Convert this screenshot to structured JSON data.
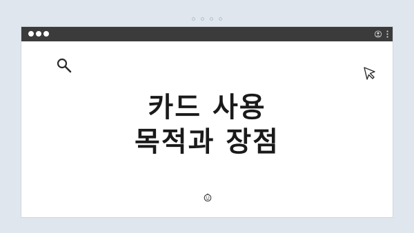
{
  "page": {
    "heading_line1": "카드 사용",
    "heading_line2": "목적과 장점"
  },
  "icons": {
    "titlebar_dots": "three-dots",
    "user": "user-icon",
    "menu": "kebab-menu-icon",
    "search": "search-icon",
    "cursor": "cursor-icon",
    "smile": "smile-icon"
  },
  "colors": {
    "background": "#dfe6ed",
    "titlebar": "#3b3b3b",
    "window": "#ffffff",
    "text": "#1a1a1a"
  }
}
